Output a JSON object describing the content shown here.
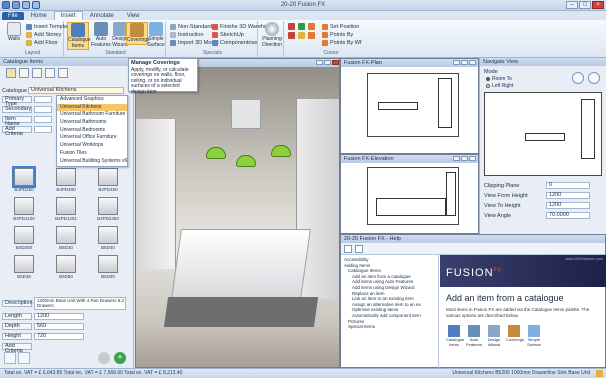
{
  "window": {
    "title": "20-20 Fusion FX"
  },
  "tabs": [
    "File",
    "Home",
    "Insert",
    "Annotate",
    "View"
  ],
  "ribbon": {
    "groups": [
      {
        "label": "Layout",
        "items": [
          "Insert Template",
          "Add Storey",
          "Add Floor"
        ],
        "big": "Walls"
      },
      {
        "label": "Standard",
        "big_buttons": [
          "Catalogue Items",
          "Auto Features",
          "Design Wizard",
          "Coverings",
          "Simple Surface"
        ]
      },
      {
        "label": "Specials",
        "items": [
          "Non-Standard",
          "Instruction",
          "Import 3D Model",
          "Finishe 3D Warehouse",
          "SketchUp",
          "Componentrise"
        ]
      },
      {
        "label": "",
        "big": "Planning Direction"
      },
      {
        "label": "Cursor",
        "items": [
          "Set Position",
          "Points By",
          "Points By Wf"
        ]
      }
    ]
  },
  "tooltip": {
    "title": "Manage Coverings",
    "body": "Apply, modify, or calculate coverings on walls, floor, ceiling, or on individual surfaces of a selected design item"
  },
  "catalogue_panel": {
    "title": "Catalogue Items",
    "catalogue_label": "Catalogue",
    "catalogue_value": "Universal Kitchens",
    "fields": [
      {
        "label": "Primary Type",
        "value": ""
      },
      {
        "label": "Secondary",
        "value": ""
      },
      {
        "label": "Item Name",
        "value": ""
      },
      {
        "label": "Add Criteria",
        "value": ""
      }
    ],
    "dropdown_options": [
      "Advanced Graphics",
      "Universal Kitchens",
      "Universal Bathroom Furniture",
      "Universal Bathrooms",
      "Universal Bedrooms",
      "Universal Office Furniture",
      "Universal Worktops",
      "Fusion Tiles",
      "Universal Building Systems v6"
    ],
    "dropdown_selected_index": 1,
    "items": [
      "B4PD250",
      "B4PD400",
      "B4PD450",
      "B4PD1100",
      "B4PD1201",
      "B4PD2350",
      "B4D250",
      "B5D30",
      "B5D40",
      "B5D45",
      "B5D50",
      "B5D60"
    ],
    "selected_item_index": 0,
    "description_label": "Description",
    "description": "1200mm Base Unit With 4 Pan Drawers 8.2 Drawers",
    "length_label": "Length",
    "length": "1200",
    "depth_label": "Depth",
    "depth": "560",
    "height_label": "Height",
    "height": "720",
    "add_criteria": "Add Criteria"
  },
  "viewport": {
    "title": "3D"
  },
  "plan_window": {
    "title": "Fusion FX-Plan"
  },
  "elevation_window": {
    "title": "Fusion FX-Elevation"
  },
  "navigator": {
    "title": "Navigate View",
    "mode_label": "Mode",
    "mode_options": [
      "Room To",
      "Left Right"
    ],
    "fields": [
      {
        "label": "Clipping Plane",
        "value": "0"
      },
      {
        "label": "View From Height",
        "value": "1200"
      },
      {
        "label": "View To Height",
        "value": "1200"
      },
      {
        "label": "View Angle",
        "value": "70.0000"
      }
    ]
  },
  "help": {
    "title": "20-20 Fusion FX - Help",
    "url": "www.2020fusion.com",
    "brand": "FUSION",
    "brand_suffix": "FX",
    "heading": "Add an item from a catalogue",
    "text": "Most items in Fusion FX are added via the Catalogue Items palette. The various options are described below.",
    "tree": [
      "Accessibility",
      "Adding Items",
      "Catalogue Items",
      "Add an item from a catalogue",
      "Add items using Auto Features",
      "Add items using Design Wizard",
      "Replace an item",
      "Link an item to an existing item",
      "Assign an alternative item to an ex",
      "Optimise existing items",
      "Automatically add component item",
      "Pictures",
      "Special Items"
    ],
    "icons": [
      "Catalogue Items",
      "Auto Features",
      "Design Wizard",
      "Coverings",
      "Simple Surface"
    ]
  },
  "status": {
    "left": "Total ex. VAT = £ 6,643.85    Total inc. VAT = £ 7,568.60    Total ex. VAT = £ 8,213.40",
    "right": "Universal Kitchens    B5200    1000mm Drawerline Sink Base Unit"
  }
}
